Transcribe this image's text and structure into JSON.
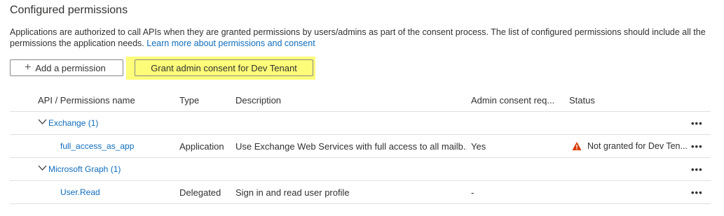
{
  "section": {
    "title": "Configured permissions",
    "description": "Applications are authorized to call APIs when they are granted permissions by users/admins as part of the consent process. The list of configured permissions should include all the permissions the application needs.",
    "learn_more": "Learn more about permissions and consent"
  },
  "toolbar": {
    "add_permission": "Add a permission",
    "grant_consent": "Grant admin consent for Dev Tenant"
  },
  "table": {
    "headers": {
      "name": "API / Permissions name",
      "type": "Type",
      "description": "Description",
      "admin_consent": "Admin consent req...",
      "status": "Status"
    },
    "groups": [
      {
        "label": "Exchange (1)",
        "permissions": [
          {
            "name": "full_access_as_app",
            "type": "Application",
            "description": "Use Exchange Web Services with full access to all mailb...",
            "admin_consent": "Yes",
            "status": "Not granted for Dev Ten..."
          }
        ]
      },
      {
        "label": "Microsoft Graph (1)",
        "permissions": [
          {
            "name": "User.Read",
            "type": "Delegated",
            "description": "Sign in and read user profile",
            "admin_consent": "-",
            "status": ""
          }
        ]
      }
    ],
    "more_label": "•••"
  },
  "colors": {
    "link": "#0f6cbd",
    "highlight": "#fdfd7a",
    "warning": "#d83b01"
  }
}
